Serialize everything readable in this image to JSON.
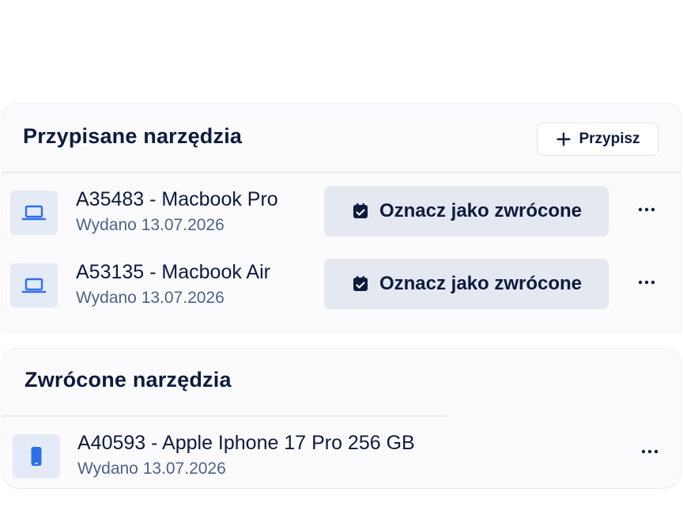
{
  "assigned": {
    "title": "Przypisane narzędzia",
    "assign_label": "Przypisz",
    "items": [
      {
        "name": "A35483 - Macbook Pro",
        "issued": "Wydano 13.07.2026",
        "action_label": "Oznacz jako zwrócone",
        "icon": "laptop-icon"
      },
      {
        "name": "A53135 - Macbook Air",
        "issued": "Wydano 13.07.2026",
        "action_label": "Oznacz jako zwrócone",
        "icon": "laptop-icon"
      }
    ]
  },
  "returned": {
    "title": "Zwrócone narzędzia",
    "items": [
      {
        "name": "A40593 - Apple Iphone 17 Pro 256 GB",
        "issued": "Wydano 13.07.2026",
        "icon": "phone-icon"
      }
    ]
  },
  "colors": {
    "accent": "#2f6fe8",
    "text": "#0f1b3d",
    "muted": "#4f6387",
    "button_bg": "#e3e8f1",
    "thumb_bg": "#e4ebf7"
  }
}
